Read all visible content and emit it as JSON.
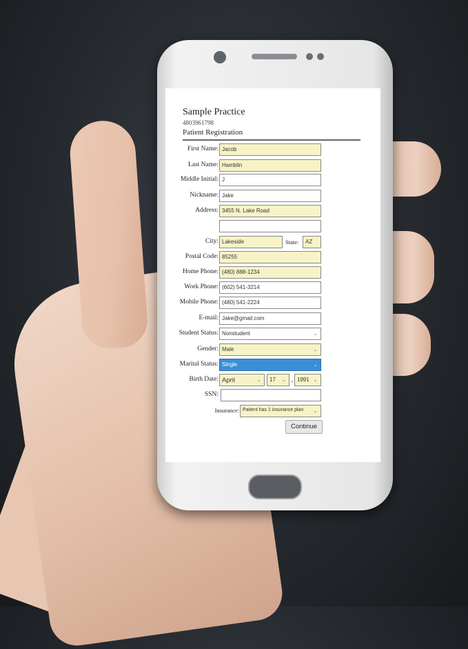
{
  "header": {
    "practice_name": "Sample Practice",
    "practice_phone": "4803961798",
    "form_title": "Patient Registration"
  },
  "form": {
    "first_name": {
      "label": "First Name:",
      "value": "Jacob"
    },
    "last_name": {
      "label": "Last Name:",
      "value": "Hamblin"
    },
    "middle_initial": {
      "label": "Middle Initial:",
      "value": "J"
    },
    "nickname": {
      "label": "Nickname:",
      "value": "Jake"
    },
    "address": {
      "label": "Address:",
      "value": "3455 N. Lake Road",
      "value2": ""
    },
    "city": {
      "label": "City:",
      "value": "Lakeside"
    },
    "state": {
      "label": "State:",
      "value": "AZ"
    },
    "postal_code": {
      "label": "Postal Code:",
      "value": "85255"
    },
    "home_phone": {
      "label": "Home Phone:",
      "value": "(480) 888-1234"
    },
    "work_phone": {
      "label": "Work Phone:",
      "value": "(602) 541-3214"
    },
    "mobile_phone": {
      "label": "Mobile Phone:",
      "value": "(480) 541-2224"
    },
    "email": {
      "label": "E-mail:",
      "value": "Jake@gmail.com"
    },
    "student_status": {
      "label": "Student Status:",
      "value": "Nonstudent"
    },
    "gender": {
      "label": "Gender:",
      "value": "Male"
    },
    "marital_status": {
      "label": "Marital Status:",
      "value": "Single"
    },
    "birth_date": {
      "label": "Birth Date:",
      "month": "April",
      "day": "17",
      "year": "1991",
      "sep": ","
    },
    "ssn": {
      "label": "SSN:",
      "value": ""
    },
    "insurance": {
      "label": "Insurance:",
      "value": "Patient has 1 insurance plan"
    },
    "continue_label": "Continue"
  },
  "colors": {
    "required_field": "#f8f3c6",
    "selected_option": "#3a8fd6"
  }
}
